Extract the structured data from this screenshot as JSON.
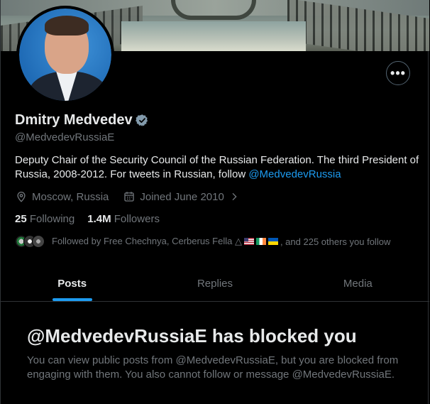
{
  "profile": {
    "name": "Dmitry Medvedev",
    "handle": "@MedvedevRussiaE",
    "bio_text": "Deputy Chair of the Security Council of the Russian Federation. The third President of Russia, 2008-2012. For tweets in Russian, follow ",
    "bio_link": "@MedvedevRussia",
    "location": "Moscow, Russia",
    "joined": "Joined June 2010",
    "following_count": "25",
    "following_label": "Following",
    "followers_count": "1.4M",
    "followers_label": "Followers",
    "followed_by_prefix": "Followed by Free Chechnya, Cerberus Fella △",
    "followed_by_suffix": ", and 225 others you follow"
  },
  "actions": {
    "more_label": "•••"
  },
  "tabs": [
    {
      "label": "Posts",
      "active": true
    },
    {
      "label": "Replies",
      "active": false
    },
    {
      "label": "Media",
      "active": false
    }
  ],
  "blocked": {
    "title": "@MedvedevRussiaE has blocked you",
    "message": "You can view public posts from @MedvedevRussiaE, but you are blocked from engaging with them. You also cannot follow or message @MedvedevRussiaE."
  },
  "colors": {
    "accent": "#1d9bf0",
    "background": "#000000",
    "text_primary": "#e7e9ea",
    "text_secondary": "#71767b",
    "verified_badge": "#829aab"
  },
  "icons": [
    "verified-badge-icon",
    "location-pin-icon",
    "calendar-icon",
    "chevron-right-icon",
    "more-horizontal-icon"
  ]
}
